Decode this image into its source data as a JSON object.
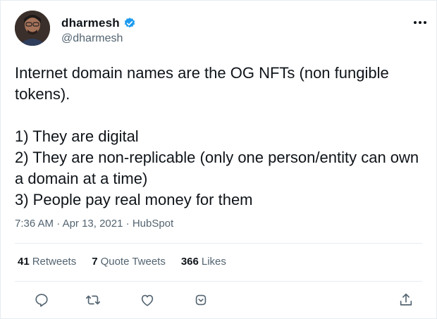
{
  "author": {
    "display_name": "dharmesh",
    "handle": "@dharmesh",
    "verified": true,
    "avatar_icon": "profile-photo"
  },
  "tweet": {
    "lines": [
      "Internet domain names are the OG NFTs (non fungible tokens).",
      "",
      "1) They are digital",
      "2) They are non-replicable (only one person/entity can own a domain at a time)",
      "3) People pay real money for them"
    ],
    "time": "7:36 AM",
    "date": "Apr 13, 2021",
    "source": "HubSpot",
    "separator": "·"
  },
  "stats": {
    "retweets_count": "41",
    "retweets_label": "Retweets",
    "quotes_count": "7",
    "quotes_label": "Quote Tweets",
    "likes_count": "366",
    "likes_label": "Likes"
  },
  "actions": [
    {
      "icon": "reply-icon"
    },
    {
      "icon": "retweet-icon"
    },
    {
      "icon": "like-icon"
    },
    {
      "icon": "bookmark-icon"
    },
    {
      "icon": "share-icon"
    }
  ],
  "colors": {
    "text": "#0f1419",
    "secondary": "#536471",
    "verified": "#1d9bf0",
    "divider": "#e6ecf0"
  }
}
